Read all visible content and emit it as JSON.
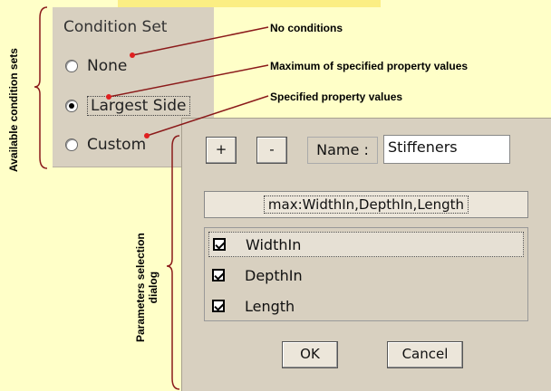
{
  "condition_panel": {
    "title": "Condition Set",
    "options": [
      {
        "label": "None",
        "selected": false
      },
      {
        "label": "Largest Side",
        "selected": true
      },
      {
        "label": "Custom",
        "selected": false
      }
    ]
  },
  "annotations": {
    "side_label": "Available condition sets",
    "none_note": "No conditions",
    "largest_note": "Maximum of specified property values",
    "custom_note": "Specified property values",
    "dialog_label_line1": "Parameters selection",
    "dialog_label_line2": "dialog"
  },
  "dialog": {
    "add_label": "+",
    "remove_label": "-",
    "name_label": "Name :",
    "name_value": "Stiffeners",
    "formula": "max:WidthIn,DepthIn,Length",
    "params": [
      {
        "label": "WidthIn",
        "checked": true
      },
      {
        "label": "DepthIn",
        "checked": true
      },
      {
        "label": "Length",
        "checked": true
      }
    ],
    "ok_label": "OK",
    "cancel_label": "Cancel"
  },
  "colors": {
    "background": "#ffffc8",
    "top_band": "#fbee84",
    "panel": "#d8d0c0",
    "leader_line": "#8b1a1a",
    "leader_dot": "#e02020"
  }
}
